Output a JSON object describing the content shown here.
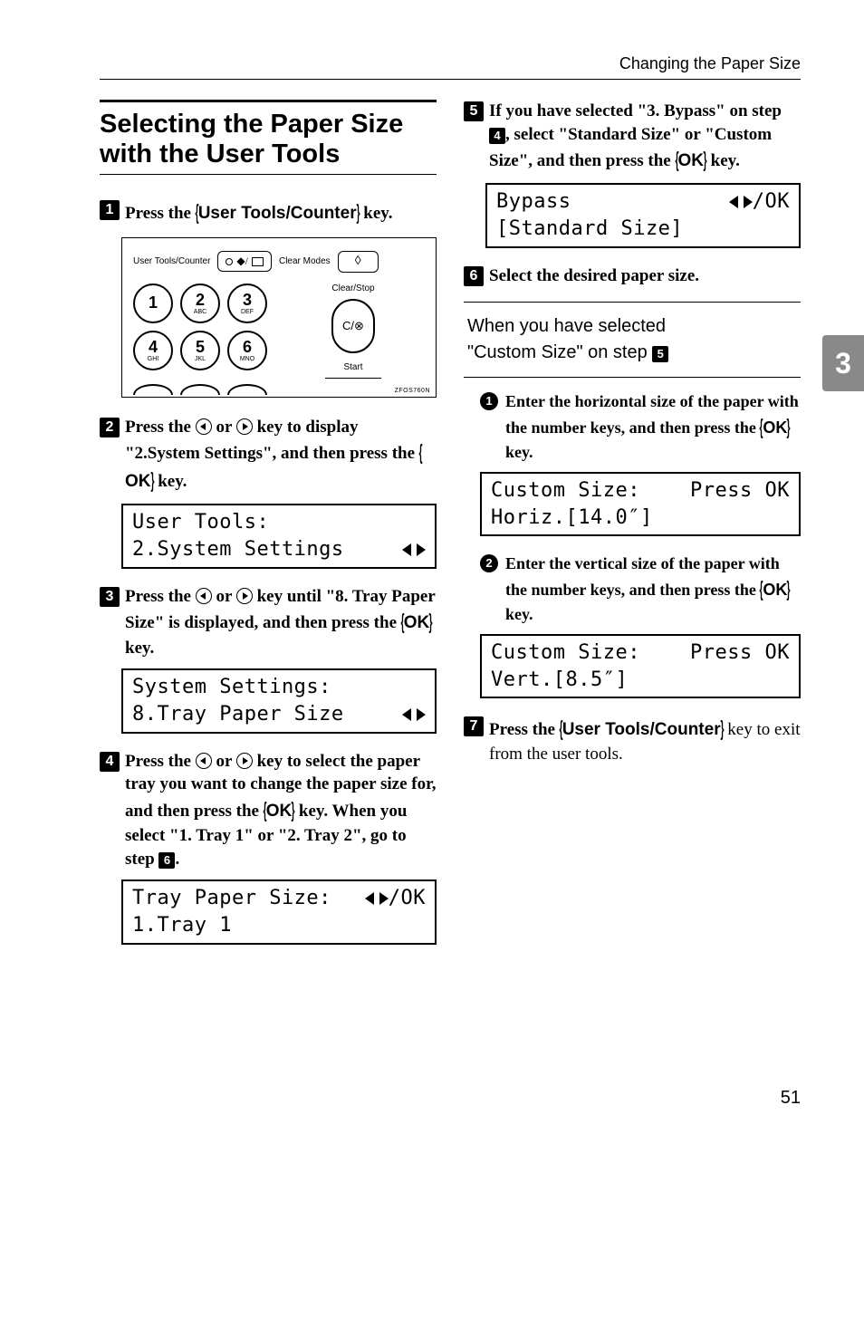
{
  "running_head": "Changing the Paper Size",
  "section_title": "Selecting the Paper Size with the User Tools",
  "side_tab": "3",
  "page_number": "51",
  "figure": {
    "label_user_tools": "User Tools/Counter",
    "label_clear_modes": "Clear Modes",
    "label_clear_stop": "Clear/Stop",
    "label_start": "Start",
    "cs_key": "C/⊗",
    "code": "ZFOS760N",
    "keys": [
      {
        "n": "1",
        "sub": ""
      },
      {
        "n": "2",
        "sub": "ABC"
      },
      {
        "n": "3",
        "sub": "DEF"
      },
      {
        "n": "4",
        "sub": "GHI"
      },
      {
        "n": "5",
        "sub": "JKL"
      },
      {
        "n": "6",
        "sub": "MNO"
      }
    ]
  },
  "steps": {
    "s1": {
      "pre": "Press the ",
      "key": "User Tools/Counter",
      "post": " key."
    },
    "s2": {
      "pre": "Press the ",
      "mid": " or ",
      "post1": " key to display \"2.System Settings\", and then press the ",
      "key": "OK",
      "post2": " key."
    },
    "s3": {
      "pre": "Press the ",
      "mid": " or ",
      "post1": " key until \"8. Tray Paper Size\" is displayed, and then press the ",
      "key": "OK",
      "post2": " key."
    },
    "s4": {
      "pre": "Press the ",
      "mid": " or ",
      "post1": " key to select the paper tray you want to change the paper size for, and then press the ",
      "key": "OK",
      "post2": " key. When you select \"1. Tray 1\" or \"2. Tray 2\", go to step ",
      "ref": "6",
      "post3": "."
    },
    "s5": {
      "pre": "If you have selected \"3. Bypass\" on step ",
      "ref": "4",
      "post1": ", select \"Standard Size\" or \"Custom Size\", and then press the ",
      "key": "OK",
      "post2": " key."
    },
    "s6": "Select the desired paper size.",
    "s7": {
      "pre": "Press the ",
      "key": "User Tools/Counter",
      "post": " key to exit from the user tools."
    }
  },
  "hint": {
    "line1": "When you have selected",
    "line2_pre": "\"Custom Size\" on step ",
    "ref": "5"
  },
  "subs": {
    "a": {
      "text_pre": "Enter the horizontal size of the paper with the number keys, and then press the ",
      "key": "OK",
      "text_post": " key."
    },
    "b": {
      "text_pre": "Enter the vertical size of the paper with the number keys, and then press the ",
      "key": "OK",
      "text_post": " key."
    }
  },
  "lcd": {
    "user_tools": {
      "l1": "User Tools:",
      "l2": "2.System Settings"
    },
    "sys_settings": {
      "l1": "System Settings:",
      "l2": "8.Tray Paper Size"
    },
    "tray_size": {
      "l1a": "Tray Paper Size:",
      "l1b": "/OK",
      "l2": "1.Tray 1"
    },
    "bypass": {
      "l1a": "Bypass",
      "l1b": "/OK",
      "l2": "[Standard Size]"
    },
    "custom_h": {
      "l1a": "Custom Size:",
      "l1b": "Press OK",
      "l2": "Horiz.[14.0″]"
    },
    "custom_v": {
      "l1a": "Custom Size:",
      "l1b": "Press OK",
      "l2": "Vert.[8.5″]"
    }
  }
}
